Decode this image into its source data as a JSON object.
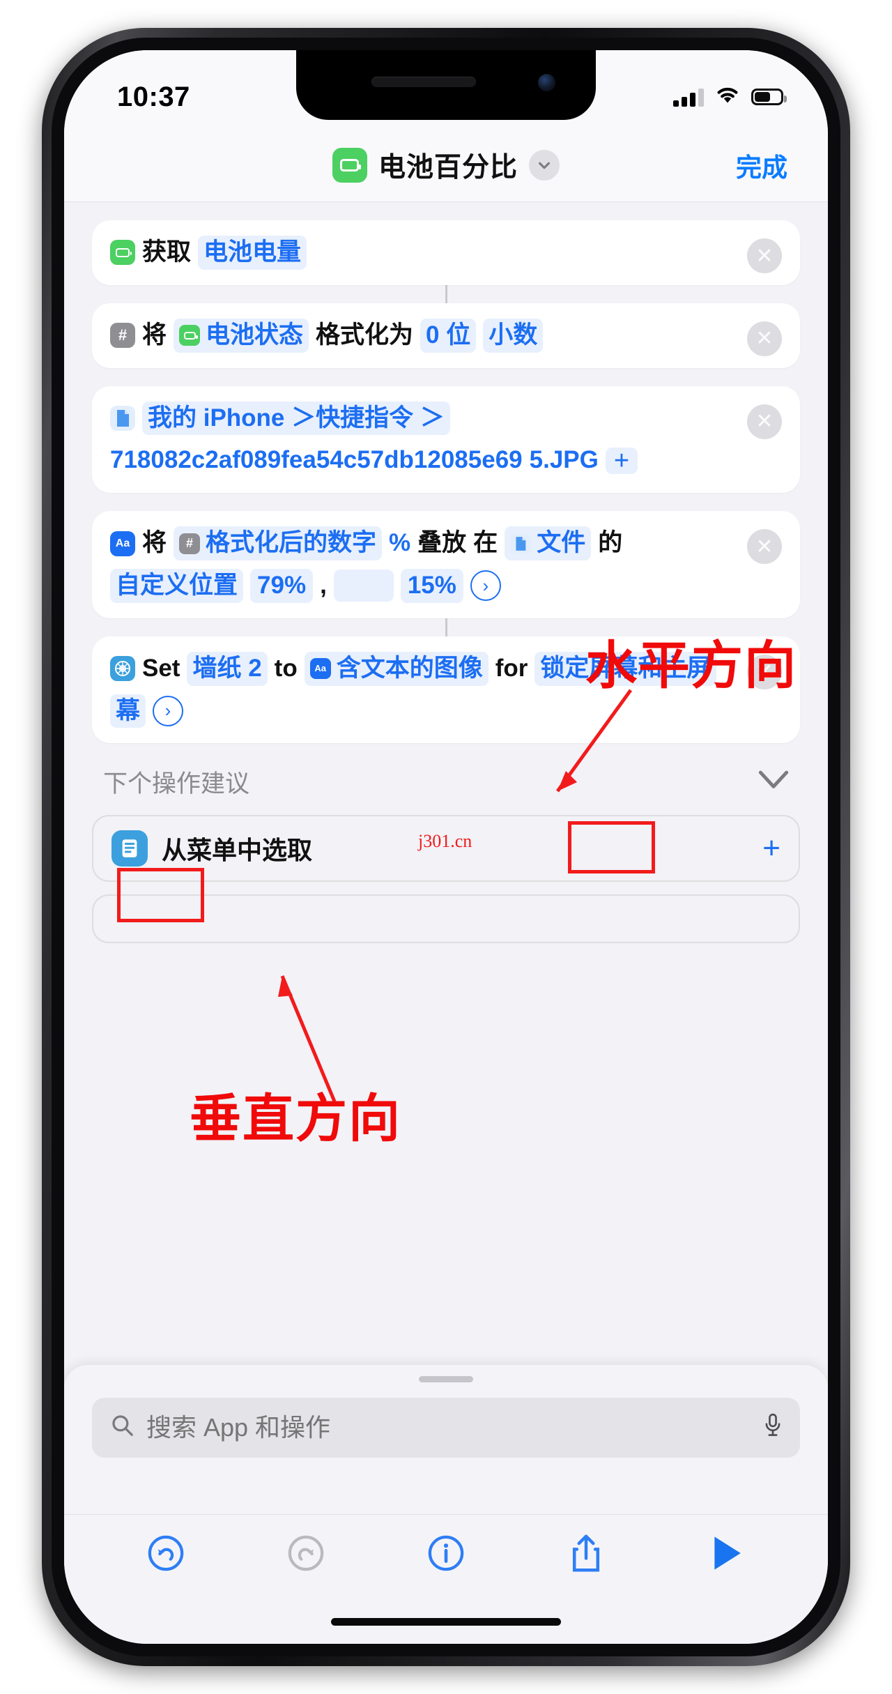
{
  "status_bar": {
    "time": "10:37",
    "cellular_icon": "cellular-signal-icon",
    "wifi_icon": "wifi-icon",
    "battery_icon": "battery-icon",
    "battery_level_pct": 55,
    "signal_bars_filled": 3,
    "signal_bars_total": 4
  },
  "nav_bar": {
    "app_icon": "battery-icon",
    "title": "电池百分比",
    "chevron_icon": "chevron-down-icon",
    "done_label": "完成"
  },
  "actions": [
    {
      "id": "get-battery-level",
      "icon": "battery-icon",
      "icon_color": "#4cd061",
      "tokens": [
        {
          "t": "text",
          "v": "获取"
        },
        {
          "t": "var",
          "v": "电池电量"
        }
      ],
      "delete_label": "✕"
    },
    {
      "id": "format-number",
      "icon": "number-hash-icon",
      "icon_color": "#8e8e93",
      "tokens": [
        {
          "t": "text",
          "v": "将"
        },
        {
          "t": "var_icon",
          "v": "电池状态",
          "icon": "battery-icon"
        },
        {
          "t": "text",
          "v": "格式化为"
        },
        {
          "t": "var",
          "v": "0 位"
        },
        {
          "t": "var",
          "v": "小数"
        }
      ],
      "delete_label": "✕"
    },
    {
      "id": "file-picker",
      "icon": "document-icon",
      "icon_color": "#3b8ef0",
      "tokens": [
        {
          "t": "var",
          "v": "我的 iPhone ＞快捷指令 ＞"
        },
        {
          "t": "var_plain",
          "v": "718082c2af089fea54c57db12085e69"
        },
        {
          "t": "var_plain",
          "v": "5.JPG"
        },
        {
          "t": "plus",
          "v": "+"
        }
      ],
      "delete_label": "✕"
    },
    {
      "id": "overlay-text-on-image",
      "icon": "text-image-icon",
      "icon_color": "#1c6ef2",
      "tokens": [
        {
          "t": "text",
          "v": "将"
        },
        {
          "t": "var_icon",
          "v": "格式化后的数字",
          "icon": "number-hash-icon",
          "suffix": "%"
        },
        {
          "t": "text",
          "v": "叠放"
        },
        {
          "t": "text",
          "v": "在"
        },
        {
          "t": "var_icon",
          "v": "文件",
          "icon": "document-icon"
        },
        {
          "t": "text",
          "v": "的"
        },
        {
          "t": "var",
          "v": "自定义位置"
        },
        {
          "t": "num",
          "v": "79%"
        },
        {
          "t": "text",
          "v": ","
        },
        {
          "t": "blank",
          "v": ""
        },
        {
          "t": "num",
          "v": "15%"
        },
        {
          "t": "chevron",
          "v": "›"
        }
      ],
      "delete_label": "✕"
    },
    {
      "id": "set-wallpaper",
      "icon": "wallpaper-icon",
      "icon_color": "#3ba0dd",
      "tokens": [
        {
          "t": "text",
          "v": "Set"
        },
        {
          "t": "var",
          "v": "墙纸 2"
        },
        {
          "t": "text",
          "v": "to"
        },
        {
          "t": "var_icon",
          "v": "含文本的图像",
          "icon": "text-image-icon"
        },
        {
          "t": "text",
          "v": "for"
        },
        {
          "t": "var",
          "v": "锁定屏幕和主屏"
        },
        {
          "t": "var",
          "v": "幕"
        },
        {
          "t": "chevron",
          "v": "›"
        }
      ],
      "delete_label": "✕"
    }
  ],
  "suggestions": {
    "header": "下个操作建议",
    "collapse_icon": "chevron-down-icon",
    "items": [
      {
        "icon": "menu-list-icon",
        "label": "从菜单中选取",
        "add_label": "+"
      }
    ]
  },
  "search": {
    "icon": "search-icon",
    "placeholder": "搜索 App 和操作",
    "value": "",
    "mic_icon": "microphone-icon"
  },
  "toolbar": {
    "undo": "undo-icon",
    "redo": "redo-icon",
    "info": "info-icon",
    "share": "share-icon",
    "run": "play-icon"
  },
  "annotations": {
    "horizontal_label": "水平方向",
    "vertical_label": "垂直方向",
    "watermark": "j301.cn",
    "box_color": "#f21b1b"
  }
}
